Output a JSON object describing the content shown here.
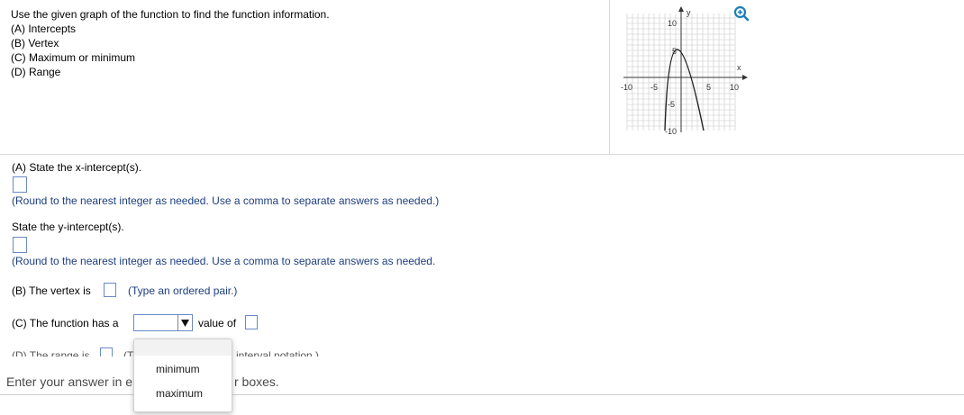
{
  "intro": {
    "line1": "Use the given graph of the function to find the function information.",
    "line2": "(A) Intercepts",
    "line3": "(B) Vertex",
    "line4": "(C) Maximum or minimum",
    "line5": "(D) Range"
  },
  "graph": {
    "y_label": "y",
    "x_label": "x",
    "x_ticks": [
      "-10",
      "-5",
      "5",
      "10"
    ],
    "y_ticks": [
      "10",
      "5",
      "-5",
      "-10"
    ]
  },
  "zoom_icon": "zoom-in-icon",
  "partA": {
    "question": "(A) State the x-intercept(s).",
    "hint1": "(Round to the nearest integer as needed. Use a comma to separate answers as needed.)",
    "y_question": "State the y-intercept(s).",
    "hint2": "(Round to the nearest integer as needed. Use a comma to separate answers as needed."
  },
  "partB": {
    "prefix": "(B) The vertex is",
    "hint": "(Type an ordered pair.)"
  },
  "partC": {
    "prefix": "(C) The function has a",
    "suffix": "value of"
  },
  "partD": {
    "prefix_partial": "(D) The range is",
    "hint_partial": "(T",
    "hint_tail": "interval notation.)"
  },
  "dropdown": {
    "options": [
      "minimum",
      "maximum"
    ]
  },
  "footer": {
    "left": "Enter your answer in e",
    "right": "r boxes."
  },
  "colors": {
    "hint_text": "#1d3e7f",
    "box_border": "#6a8ac7",
    "zoom_icon": "#1a7fb8"
  }
}
